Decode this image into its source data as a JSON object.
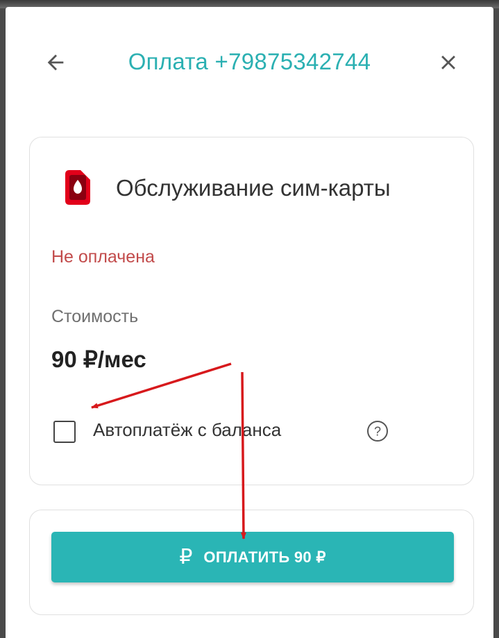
{
  "header": {
    "title": "Оплата +79875342744",
    "back_icon": "arrow-left-icon",
    "close_icon": "close-icon"
  },
  "service": {
    "icon": "sim-card-icon",
    "name": "Обслуживание сим-карты",
    "status": "Не оплачена",
    "cost_label": "Стоимость",
    "cost_value": "90 ₽/мес",
    "autopay_checked": false,
    "autopay_label": "Автоплатёж с баланса",
    "help_icon": "question-circle-icon"
  },
  "pay_button": {
    "icon": "ruble-icon",
    "icon_glyph": "₽",
    "label": "ОПЛАТИТЬ 90 ₽"
  },
  "annotations": {
    "arrow_color": "#d7191c",
    "arrows": [
      "arrow-to-autopay-checkbox",
      "arrow-to-pay-button"
    ]
  },
  "colors": {
    "accent": "#2bb0b2",
    "button": "#2ab5b5",
    "status_unpaid": "#c24b4b",
    "sim_icon": "#e2001a"
  }
}
